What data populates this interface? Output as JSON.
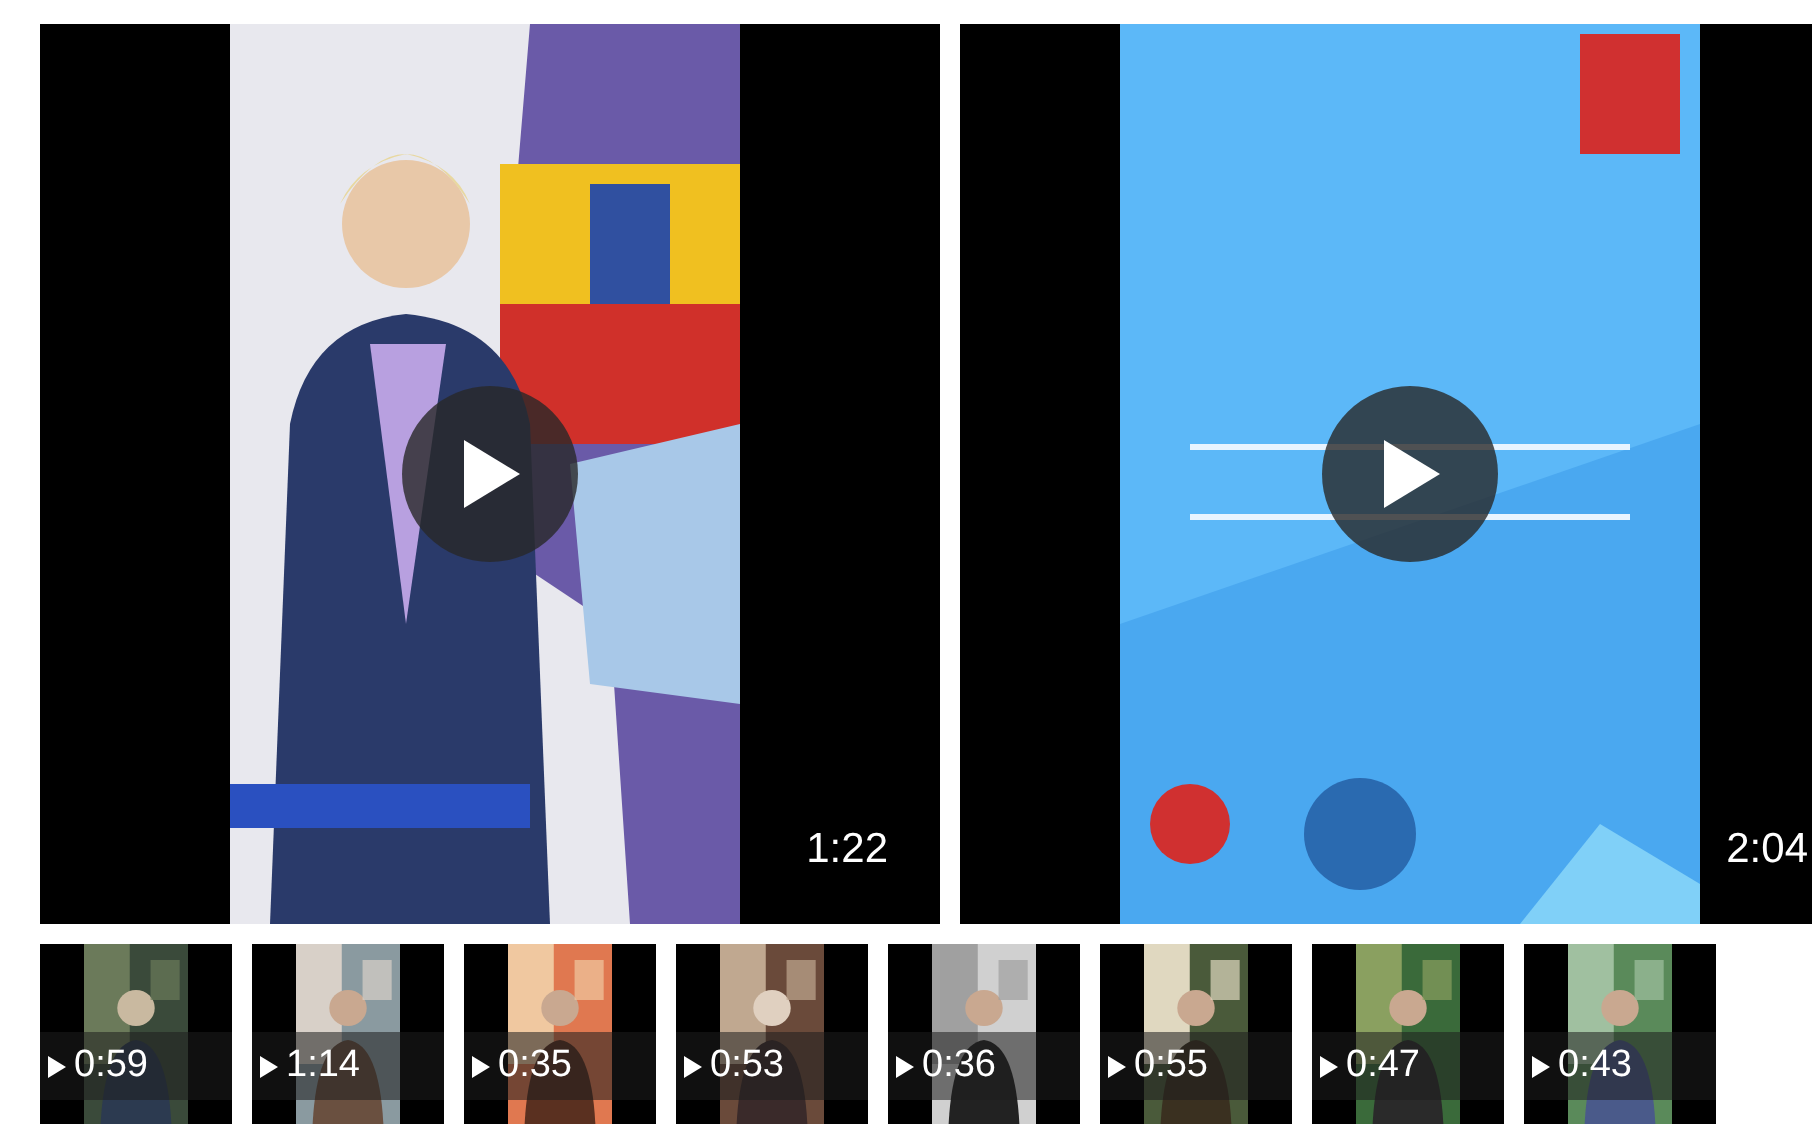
{
  "featured": [
    {
      "duration": "1:22",
      "kind": "picture"
    },
    {
      "duration": "2:04",
      "kind": "picture"
    }
  ],
  "thumbnails": [
    {
      "duration": "0:59"
    },
    {
      "duration": "1:14"
    },
    {
      "duration": "0:35"
    },
    {
      "duration": "0:53"
    },
    {
      "duration": "0:36"
    },
    {
      "duration": "0:55"
    },
    {
      "duration": "0:47"
    },
    {
      "duration": "0:43"
    }
  ]
}
